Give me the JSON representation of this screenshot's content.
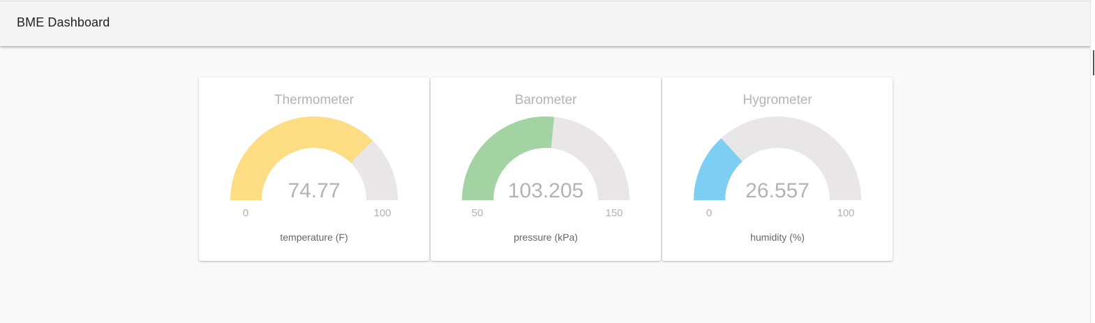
{
  "header": {
    "title": "BME Dashboard"
  },
  "gauges": [
    {
      "title": "Thermometer",
      "value": "74.77",
      "min": "0",
      "max": "100",
      "label": "temperature (F)",
      "fill_fraction": 0.7477,
      "color": "#fddd84",
      "track_color": "#e8e6e6"
    },
    {
      "title": "Barometer",
      "value": "103.205",
      "min": "50",
      "max": "150",
      "label": "pressure (kPa)",
      "fill_fraction": 0.53205,
      "color": "#a3d2a3",
      "track_color": "#e8e6e6"
    },
    {
      "title": "Hygrometer",
      "value": "26.557",
      "min": "0",
      "max": "100",
      "label": "humidity (%)",
      "fill_fraction": 0.26557,
      "color": "#7ecdf3",
      "track_color": "#e8e6e6"
    }
  ]
}
